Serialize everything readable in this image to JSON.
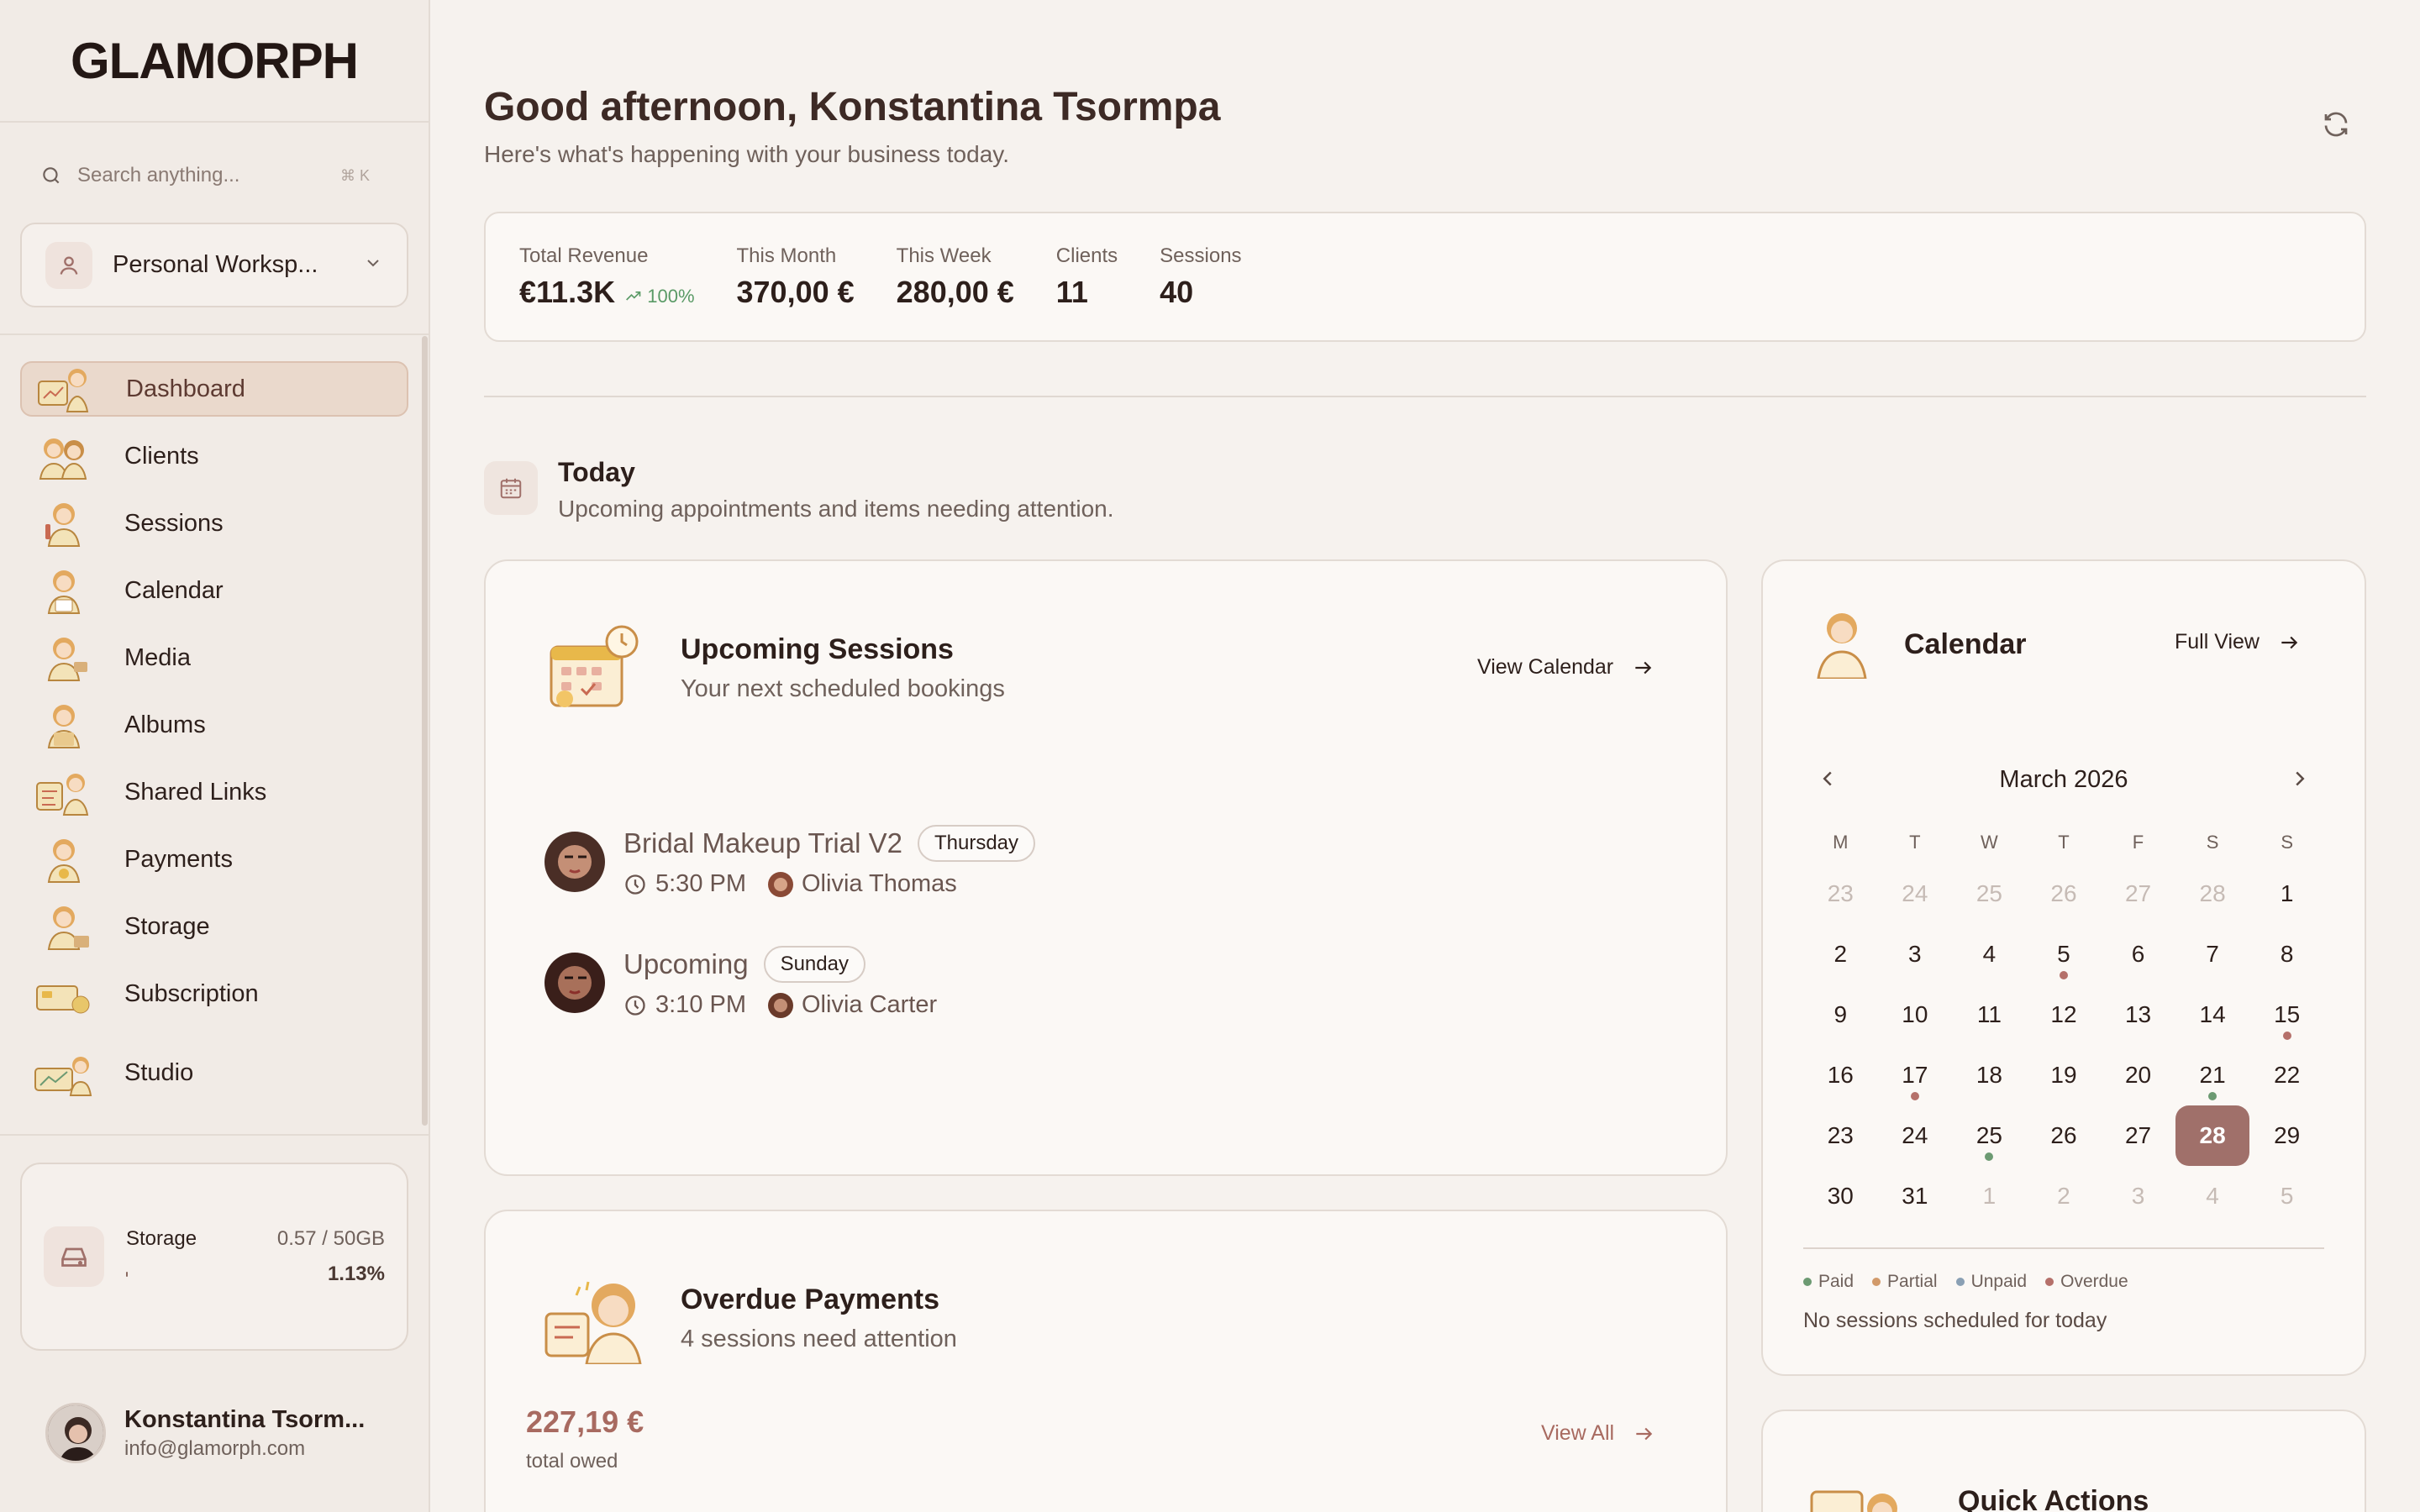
{
  "sidebar": {
    "logo": "GLAMORPH",
    "search_placeholder": "Search anything...",
    "search_shortcut": "⌘ K",
    "workspace": "Personal Worksp...",
    "nav": [
      {
        "label": "Dashboard",
        "icon": "dashboard-icon"
      },
      {
        "label": "Clients",
        "icon": "clients-icon"
      },
      {
        "label": "Sessions",
        "icon": "sessions-icon"
      },
      {
        "label": "Calendar",
        "icon": "calendar-icon"
      },
      {
        "label": "Media",
        "icon": "media-icon"
      },
      {
        "label": "Albums",
        "icon": "albums-icon"
      },
      {
        "label": "Shared Links",
        "icon": "shared-links-icon"
      },
      {
        "label": "Payments",
        "icon": "payments-icon"
      },
      {
        "label": "Storage",
        "icon": "storage-icon"
      },
      {
        "label": "Subscription",
        "icon": "subscription-icon"
      },
      {
        "label": "Studio",
        "icon": "studio-icon"
      }
    ],
    "storage": {
      "label": "Storage",
      "value": "0.57 / 50GB",
      "percent": "1.13%",
      "fraction": 0.0113
    },
    "user": {
      "name": "Konstantina Tsorm...",
      "email": "info@glamorph.com"
    }
  },
  "header": {
    "greeting": "Good afternoon, Konstantina Tsormpa",
    "subtitle": "Here's what's happening with your business today."
  },
  "stats": [
    {
      "label": "Total Revenue",
      "value": "€11.3K",
      "trend": "100%"
    },
    {
      "label": "This Month",
      "value": "370,00 €"
    },
    {
      "label": "This Week",
      "value": "280,00 €"
    },
    {
      "label": "Clients",
      "value": "11"
    },
    {
      "label": "Sessions",
      "value": "40"
    }
  ],
  "today": {
    "title": "Today",
    "subtitle": "Upcoming appointments and items needing attention."
  },
  "upcoming": {
    "title": "Upcoming Sessions",
    "subtitle": "Your next scheduled bookings",
    "link": "View Calendar",
    "sessions": [
      {
        "name": "Bridal Makeup Trial V2",
        "day": "Thursday",
        "time": "5:30 PM",
        "client": "Olivia Thomas"
      },
      {
        "name": "Upcoming",
        "day": "Sunday",
        "time": "3:10 PM",
        "client": "Olivia Carter"
      }
    ]
  },
  "overdue": {
    "title": "Overdue Payments",
    "subtitle": "4 sessions need attention",
    "amount": "227,19 €",
    "amount_label": "total owed",
    "link": "View All"
  },
  "calendar": {
    "title": "Calendar",
    "link": "Full View",
    "month": "March 2026",
    "weekdays": [
      "M",
      "T",
      "W",
      "T",
      "F",
      "S",
      "S"
    ],
    "weeks": [
      [
        "23",
        "24",
        "25",
        "26",
        "27",
        "28",
        "1"
      ],
      [
        "2",
        "3",
        "4",
        "5",
        "6",
        "7",
        "8"
      ],
      [
        "9",
        "10",
        "11",
        "12",
        "13",
        "14",
        "15"
      ],
      [
        "16",
        "17",
        "18",
        "19",
        "20",
        "21",
        "22"
      ],
      [
        "23",
        "24",
        "25",
        "26",
        "27",
        "28",
        "29"
      ],
      [
        "30",
        "31",
        "1",
        "2",
        "3",
        "4",
        "5"
      ]
    ],
    "legend": [
      "Paid",
      "Partial",
      "Unpaid",
      "Overdue"
    ],
    "empty_text": "No sessions scheduled for today",
    "colors": {
      "paid": "#6c9a72",
      "partial": "#d29a6a",
      "unpaid": "#8aa0b4",
      "overdue": "#b5706a"
    }
  },
  "quick_actions": {
    "title": "Quick Actions"
  }
}
